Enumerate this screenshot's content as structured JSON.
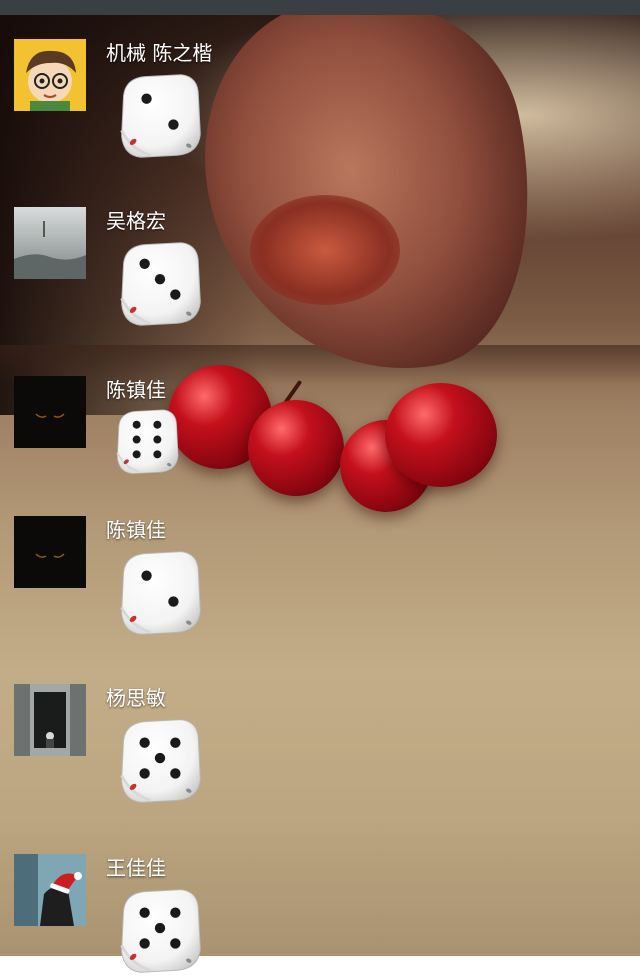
{
  "contacts": [
    {
      "name": "机械 陈之楷",
      "dice_value": 2,
      "avatar_icon": "cartoon-boy-avatar-icon"
    },
    {
      "name": "吴格宏",
      "dice_value": 3,
      "avatar_icon": "misty-landscape-avatar-icon"
    },
    {
      "name": "陈镇佳",
      "dice_value": 6,
      "avatar_icon": "dark-eyes-avatar-icon"
    },
    {
      "name": "陈镇佳",
      "dice_value": 2,
      "avatar_icon": "dark-eyes-avatar-icon"
    },
    {
      "name": "杨思敏",
      "dice_value": 5,
      "avatar_icon": "doorway-avatar-icon"
    },
    {
      "name": "王佳佳",
      "dice_value": 5,
      "avatar_icon": "santa-hat-avatar-icon"
    }
  ],
  "colors": {
    "status_bar": "#3a3f44",
    "name_text": "#ffffff",
    "dice_face": "#f3f3f3",
    "dice_pip": "#1a1a1a",
    "dice_accent": "#c8322a"
  }
}
